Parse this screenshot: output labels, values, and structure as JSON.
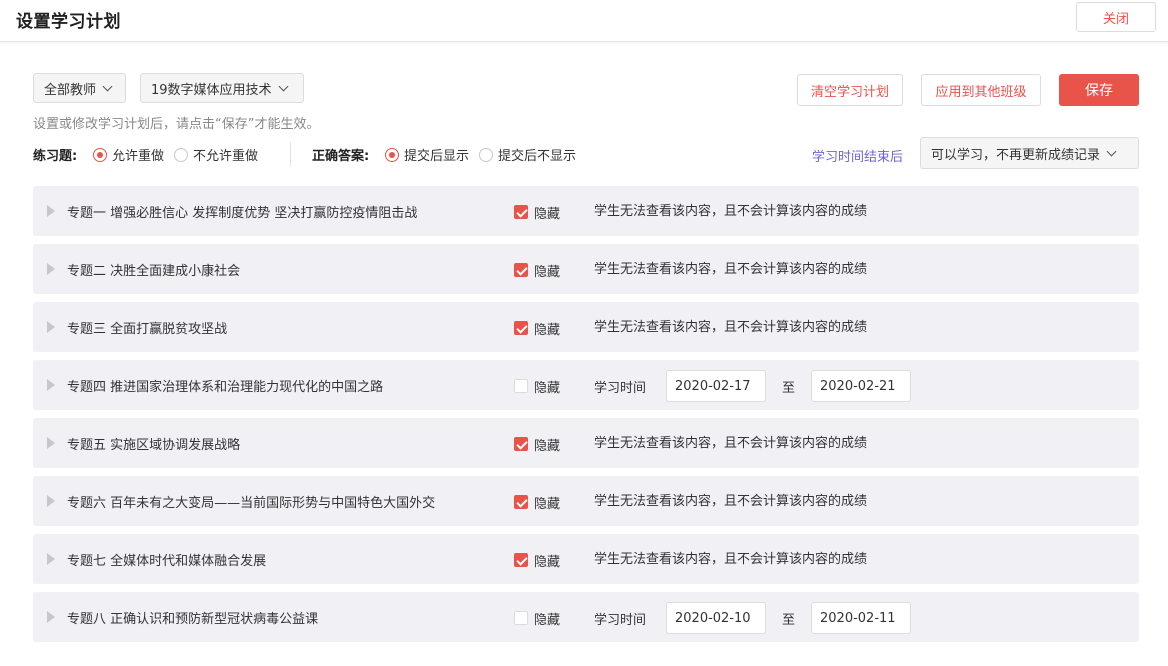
{
  "header": {
    "title": "设置学习计划",
    "close_label": "关闭"
  },
  "filters": {
    "teacher": "全部教师",
    "class": "19数字媒体应用技术"
  },
  "tip": "设置或修改学习计划后，请点击“保存”才能生效。",
  "actions": {
    "clear": "清空学习计划",
    "apply_other": "应用到其他班级",
    "save": "保存"
  },
  "exercise": {
    "label": "练习题:",
    "options": [
      {
        "label": "允许重做",
        "selected": true
      },
      {
        "label": "不允许重做",
        "selected": false
      }
    ]
  },
  "answer": {
    "label": "正确答案:",
    "options": [
      {
        "label": "提交后显示",
        "selected": true
      },
      {
        "label": "提交后不显示",
        "selected": false
      }
    ]
  },
  "after_time": {
    "label": "学习时间结束后",
    "value": "可以学习，不再更新成绩记录"
  },
  "rows_common": {
    "hide_label": "隐藏",
    "hidden_info": "学生无法查看该内容，且不会计算该内容的成绩",
    "time_label": "学习时间",
    "to_label": "至"
  },
  "topics": [
    {
      "title": "专题一 增强必胜信心 发挥制度优势 坚决打赢防控疫情阻击战",
      "hidden": true
    },
    {
      "title": "专题二 决胜全面建成小康社会",
      "hidden": true
    },
    {
      "title": "专题三 全面打赢脱贫攻坚战",
      "hidden": true
    },
    {
      "title": "专题四 推进国家治理体系和治理能力现代化的中国之路",
      "hidden": false,
      "start": "2020-02-17",
      "end": "2020-02-21"
    },
    {
      "title": "专题五 实施区域协调发展战略",
      "hidden": true
    },
    {
      "title": "专题六 百年未有之大变局——当前国际形势与中国特色大国外交",
      "hidden": true
    },
    {
      "title": "专题七 全媒体时代和媒体融合发展",
      "hidden": true
    },
    {
      "title": "专题八 正确认识和预防新型冠状病毒公益课",
      "hidden": false,
      "start": "2020-02-10",
      "end": "2020-02-11"
    }
  ],
  "colors": {
    "accent": "#e8534a",
    "link": "#6d63d8",
    "row_bg": "#f0f0f5"
  }
}
